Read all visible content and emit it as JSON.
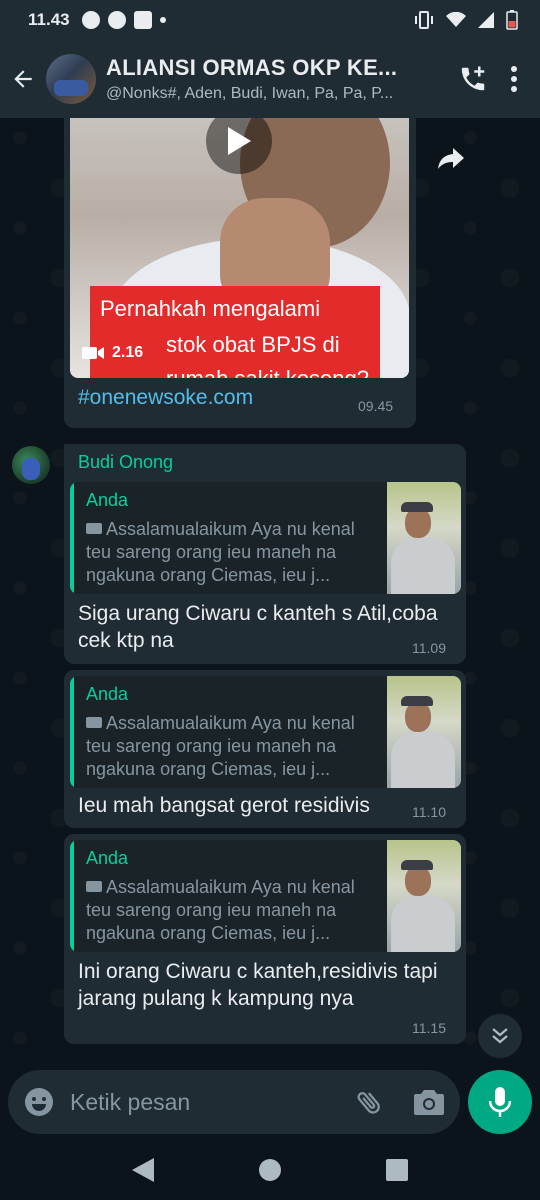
{
  "status_bar": {
    "time": "11.43"
  },
  "header": {
    "title": "ALIANSI ORMAS OKP KE...",
    "subtitle": "@Nonks#, Aden, Budi, Iwan, Pa, Pa, P..."
  },
  "video_message": {
    "caption_line1": "Pernahkah mengalami",
    "caption_line2": "stok obat BPJS di",
    "caption_line3": "rumah sakit kosong?",
    "duration": "2.16",
    "link_text": "#onenewsoke.com",
    "time": "09.45"
  },
  "messages": [
    {
      "sender": "Budi Onong",
      "quote_name": "Anda",
      "quote_text": "Assalamualaikum Aya nu kenal teu sareng orang ieu maneh na ngakuna orang Ciemas, ieu j...",
      "text": "Siga urang Ciwaru c kanteh s Atil,coba cek ktp na",
      "time": "11.09"
    },
    {
      "quote_name": "Anda",
      "quote_text": "Assalamualaikum Aya nu kenal teu sareng orang ieu maneh na ngakuna orang Ciemas, ieu j...",
      "text": "Ieu mah bangsat gerot residivis",
      "time": "11.10"
    },
    {
      "quote_name": "Anda",
      "quote_text": "Assalamualaikum Aya nu kenal teu sareng orang ieu maneh na ngakuna orang Ciemas, ieu j...",
      "text": "Ini orang Ciwaru c kanteh,residivis tapi jarang pulang k kampung nya",
      "time": "11.15"
    }
  ],
  "composer": {
    "placeholder": "Ketik pesan"
  },
  "colors": {
    "accent": "#00a884",
    "link": "#53bdeb",
    "quote_name": "#06cf9c",
    "bubble": "#202c33"
  },
  "icons": [
    "back-arrow-icon",
    "add-call-icon",
    "more-vert-icon",
    "play-icon",
    "video-camera-icon",
    "forward-icon",
    "scroll-down-icon",
    "emoji-icon",
    "attach-icon",
    "camera-icon",
    "mic-icon",
    "nav-back-icon",
    "nav-home-icon",
    "nav-recents-icon"
  ]
}
